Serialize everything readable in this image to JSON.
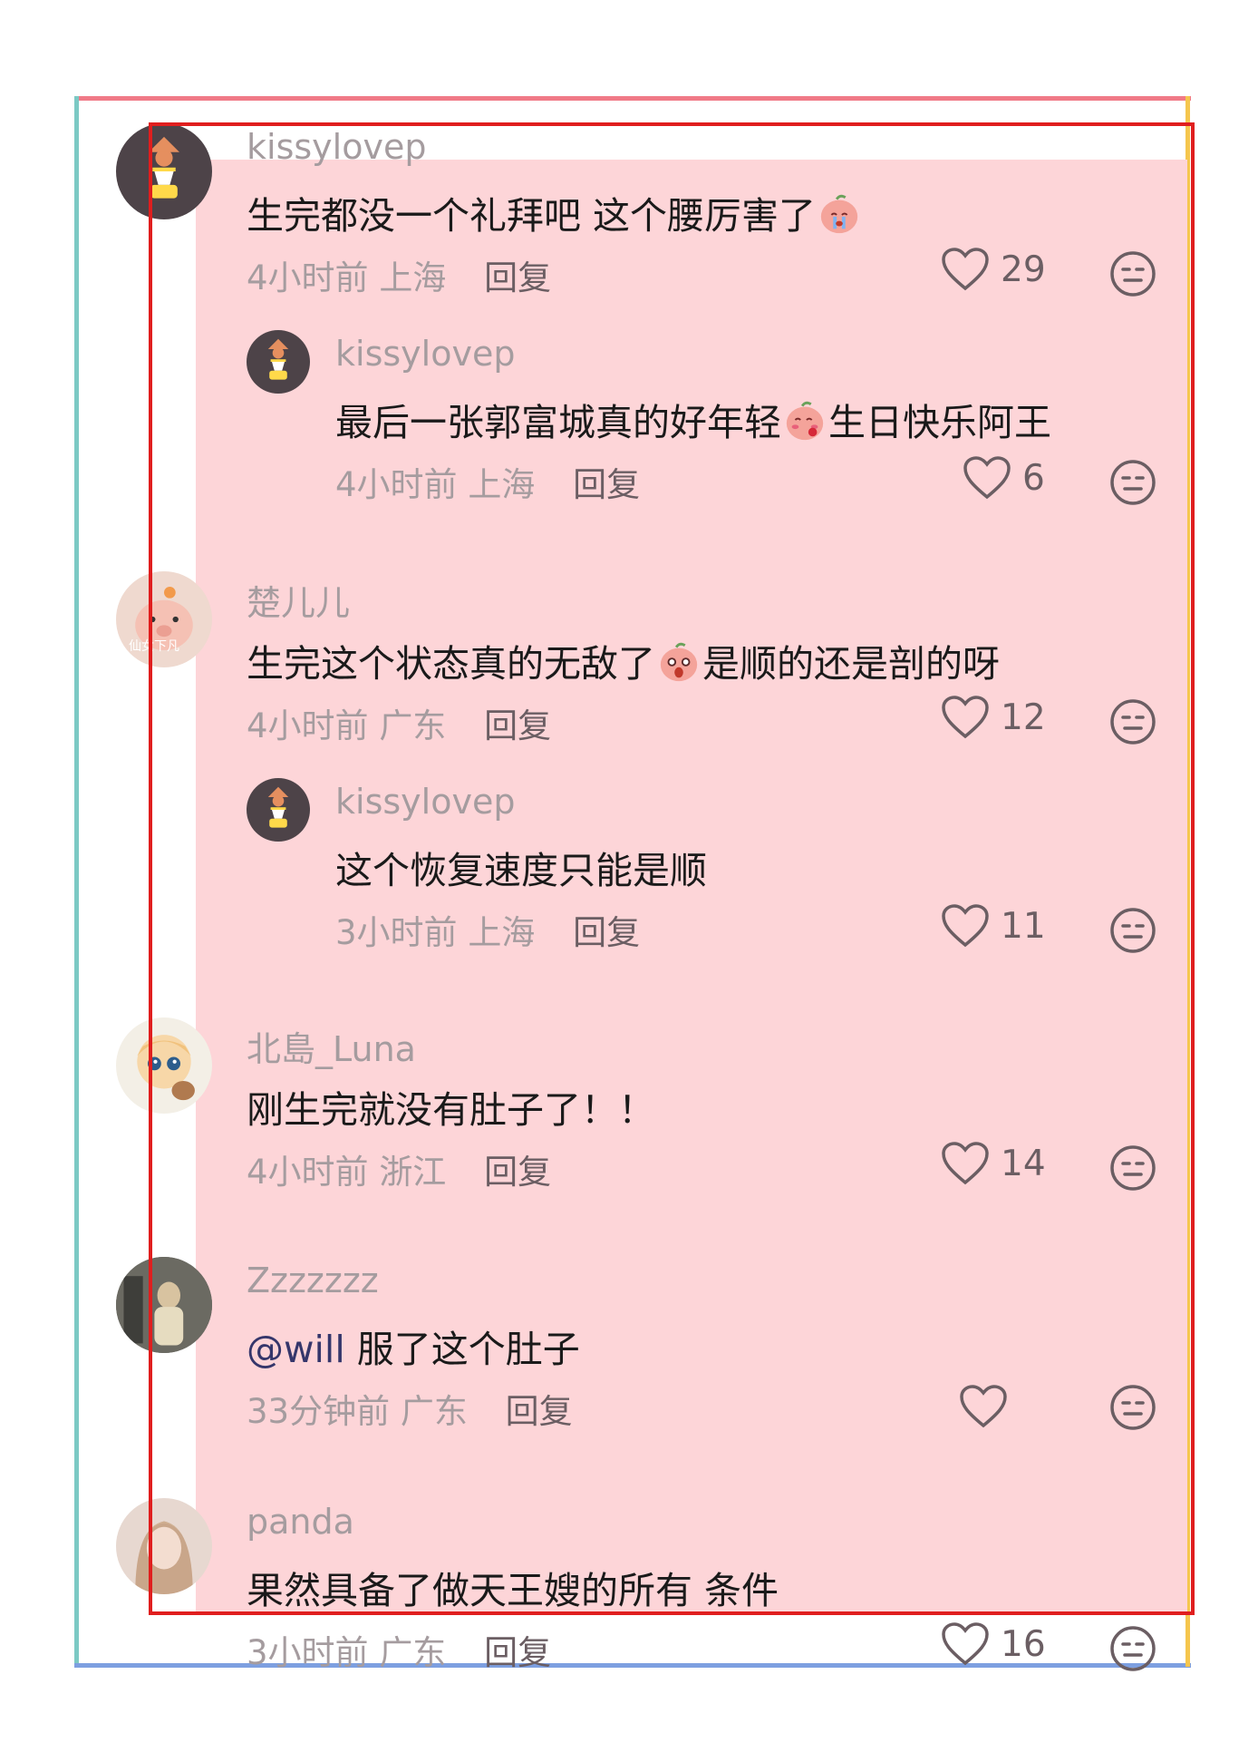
{
  "comments": [
    {
      "username": "kissylovep",
      "text": "生完都没一个礼拜吧 这个腰厉害了",
      "time": "4小时前",
      "location": "上海",
      "reply_label": "回复",
      "likes": "29"
    },
    {
      "username": "kissylovep",
      "text_part1": "最后一张郭富城真的好年轻",
      "text_part2": "生日快乐阿王",
      "time": "4小时前",
      "location": "上海",
      "reply_label": "回复",
      "likes": "6"
    },
    {
      "username": "楚儿儿",
      "text_part1": "生完这个状态真的无敌了",
      "text_part2": "是顺的还是剖的呀",
      "time": "4小时前",
      "location": "广东",
      "reply_label": "回复",
      "likes": "12",
      "avatar_caption": "仙女下凡"
    },
    {
      "username": "kissylovep",
      "text": "这个恢复速度只能是顺",
      "time": "3小时前",
      "location": "上海",
      "reply_label": "回复",
      "likes": "11"
    },
    {
      "username": "北島_Luna",
      "text": "刚生完就没有肚子了！！",
      "time": "4小时前",
      "location": "浙江",
      "reply_label": "回复",
      "likes": "14"
    },
    {
      "username": "Zzzzzzz",
      "mention": "@will",
      "text": "服了这个肚子",
      "time": "33分钟前",
      "location": "广东",
      "reply_label": "回复",
      "likes": ""
    },
    {
      "username": "panda",
      "text": "果然具备了做天王嫂的所有 条件",
      "time": "3小时前",
      "location": "广东",
      "reply_label": "回复",
      "likes": "16"
    }
  ],
  "colors": {
    "highlight": "#fdd5d8",
    "highlight_border": "#e01e1e",
    "username": "#a59c9f",
    "text": "#1a1a1a",
    "mention": "#35366b"
  },
  "icons": [
    "heart-icon",
    "dislike-face-icon",
    "emoji-crying-peach",
    "emoji-shy-peach",
    "emoji-shocked-peach"
  ]
}
